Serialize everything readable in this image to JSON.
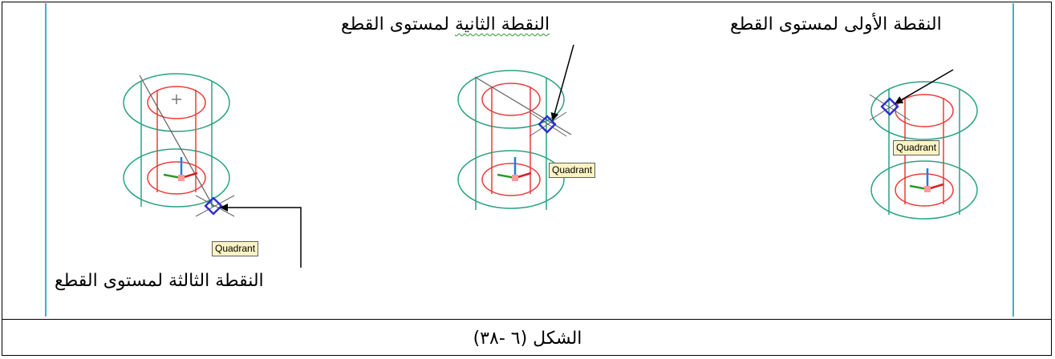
{
  "labels": {
    "first_point": "النقطة الأولى لمستوى القطع",
    "second_point_a": "النقطة الثانية",
    "second_point_b": "لمستوى القطع",
    "third_point": "النقطة الثالثة لمستوى القطع"
  },
  "tooltips": {
    "right": "Quadrant",
    "middle": "Quadrant",
    "left": "Quadrant"
  },
  "caption": "الشكل (٦ -٣٨)",
  "colors": {
    "cylinder_outer": "#2aa383",
    "cylinder_inner": "#ee3a3a",
    "snap_marker": "#3030d0",
    "frame_accent": "#3bb5c0",
    "tooltip_bg": "#fbf3c4"
  }
}
